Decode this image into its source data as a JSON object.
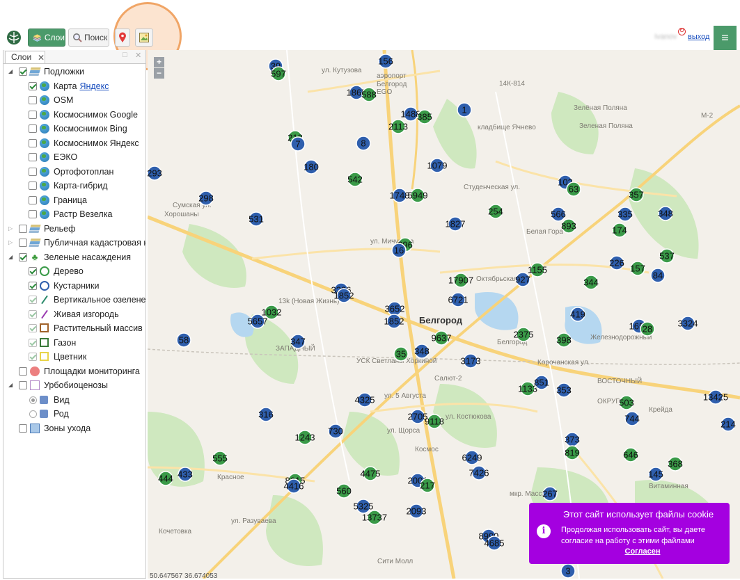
{
  "toolbar": {
    "layers_label": "Слои",
    "search_label": "Поиск",
    "user_name": "Ivanov",
    "logout_label": "выход",
    "menu_glyph": "≡"
  },
  "panel": {
    "tab_label": "Слои",
    "close_glyph": "✕",
    "items": [
      {
        "label": "Подложки"
      },
      {
        "label": "Карта ",
        "link": "Яндекс"
      },
      {
        "label": "OSM"
      },
      {
        "label": "Космоснимок Google"
      },
      {
        "label": "Космоснимок Bing"
      },
      {
        "label": "Космоснимок Яндекс"
      },
      {
        "label": "ЕЭКО"
      },
      {
        "label": "Ортофотоплан"
      },
      {
        "label": "Карта-гибрид"
      },
      {
        "label": "Граница"
      },
      {
        "label": "Растр Везелка"
      },
      {
        "label": "Рельеф"
      },
      {
        "label": "Публичная кадастровая карта"
      },
      {
        "label": "Зеленые насаждения"
      },
      {
        "label": "Дерево"
      },
      {
        "label": "Кустарники"
      },
      {
        "label": "Вертикальное озеленение"
      },
      {
        "label": "Живая изгородь"
      },
      {
        "label": "Растительный массив"
      },
      {
        "label": "Газон"
      },
      {
        "label": "Цветник"
      },
      {
        "label": "Площадки мониторинга"
      },
      {
        "label": "Урбобиоценозы"
      },
      {
        "label": "Вид"
      },
      {
        "label": "Род"
      },
      {
        "label": "Зоны ухода"
      }
    ]
  },
  "map": {
    "zoom_in": "+",
    "zoom_out": "−",
    "coords": "50.647567 36.674053",
    "city": "Белгород",
    "places": [
      {
        "t": "аэропорт"
      },
      {
        "t": "Белгород"
      },
      {
        "t": "EGO"
      },
      {
        "t": "Зелёная Поляна"
      },
      {
        "t": "Зеленая Поляна"
      },
      {
        "t": "кладбище Ячнево"
      },
      {
        "t": "Белая Гора"
      },
      {
        "t": "ул. Кутузова"
      },
      {
        "t": "Сумская ул."
      },
      {
        "t": "ул. Мичурина"
      },
      {
        "t": "Студенческая ул."
      },
      {
        "t": "Октябрьская ул."
      },
      {
        "t": "Железнодорожный"
      },
      {
        "t": "Корочанская ул."
      },
      {
        "t": "ВОСТОЧНЫЙ"
      },
      {
        "t": "ОКРУГ"
      },
      {
        "t": "ЗАПАДНЫЙ"
      },
      {
        "t": "УСК Светланы Хоркиной"
      },
      {
        "t": "Салют-2"
      },
      {
        "t": "ул. 5 Августа"
      },
      {
        "t": "ул. Костюкова"
      },
      {
        "t": "Космос"
      },
      {
        "t": "Красное"
      },
      {
        "t": "ул. Разуваева"
      },
      {
        "t": "ул. Щорса"
      },
      {
        "t": "Сити Молл"
      },
      {
        "t": "Витаминная"
      },
      {
        "t": "Крейда"
      },
      {
        "t": "13k (Новая Жизнь)"
      },
      {
        "t": "Белгород"
      },
      {
        "t": "14К-814"
      },
      {
        "t": "М-2"
      },
      {
        "t": "Хорошаны"
      },
      {
        "t": "мкр. Массив"
      },
      {
        "t": "Кочетовка"
      }
    ],
    "clusters": [
      {
        "n": "39",
        "c": "b"
      },
      {
        "n": "597",
        "c": "g"
      },
      {
        "n": "156",
        "c": "b"
      },
      {
        "n": "1865",
        "c": "b"
      },
      {
        "n": "588",
        "c": "g"
      },
      {
        "n": "1",
        "c": "b"
      },
      {
        "n": "1488",
        "c": "b"
      },
      {
        "n": "385",
        "c": "g"
      },
      {
        "n": "2113",
        "c": "g"
      },
      {
        "n": "213",
        "c": "g"
      },
      {
        "n": "7",
        "c": "b"
      },
      {
        "n": "8",
        "c": "b"
      },
      {
        "n": "293",
        "c": "b"
      },
      {
        "n": "180",
        "c": "b"
      },
      {
        "n": "1079",
        "c": "b"
      },
      {
        "n": "542",
        "c": "g"
      },
      {
        "n": "1748",
        "c": "b"
      },
      {
        "n": "5949",
        "c": "g"
      },
      {
        "n": "102",
        "c": "b"
      },
      {
        "n": "63",
        "c": "g"
      },
      {
        "n": "298",
        "c": "b"
      },
      {
        "n": "357",
        "c": "g"
      },
      {
        "n": "335",
        "c": "b"
      },
      {
        "n": "348",
        "c": "b"
      },
      {
        "n": "254",
        "c": "g"
      },
      {
        "n": "566",
        "c": "b"
      },
      {
        "n": "893",
        "c": "g"
      },
      {
        "n": "531",
        "c": "b"
      },
      {
        "n": "1827",
        "c": "b"
      },
      {
        "n": "174",
        "c": "g"
      },
      {
        "n": "296",
        "c": "g"
      },
      {
        "n": "16",
        "c": "b"
      },
      {
        "n": "537",
        "c": "g"
      },
      {
        "n": "226",
        "c": "b"
      },
      {
        "n": "157",
        "c": "g"
      },
      {
        "n": "84",
        "c": "b"
      },
      {
        "n": "1155",
        "c": "g"
      },
      {
        "n": "17907",
        "c": "g"
      },
      {
        "n": "927",
        "c": "b"
      },
      {
        "n": "344",
        "c": "g"
      },
      {
        "n": "3226",
        "c": "b"
      },
      {
        "n": "1852",
        "c": "b"
      },
      {
        "n": "6721",
        "c": "b"
      },
      {
        "n": "1032",
        "c": "g"
      },
      {
        "n": "3652",
        "c": "b"
      },
      {
        "n": "1852",
        "c": "b"
      },
      {
        "n": "419",
        "c": "b"
      },
      {
        "n": "5657",
        "c": "b"
      },
      {
        "n": "1659",
        "c": "b"
      },
      {
        "n": "28",
        "c": "g"
      },
      {
        "n": "3324",
        "c": "b"
      },
      {
        "n": "58",
        "c": "b"
      },
      {
        "n": "2375",
        "c": "g"
      },
      {
        "n": "347",
        "c": "b"
      },
      {
        "n": "9637",
        "c": "g"
      },
      {
        "n": "398",
        "c": "g"
      },
      {
        "n": "35",
        "c": "g"
      },
      {
        "n": "348",
        "c": "b"
      },
      {
        "n": "3173",
        "c": "b"
      },
      {
        "n": "1133",
        "c": "g"
      },
      {
        "n": "851",
        "c": "b"
      },
      {
        "n": "353",
        "c": "b"
      },
      {
        "n": "13425",
        "c": "b"
      },
      {
        "n": "4325",
        "c": "b"
      },
      {
        "n": "503",
        "c": "g"
      },
      {
        "n": "316",
        "c": "b"
      },
      {
        "n": "2705",
        "c": "b"
      },
      {
        "n": "9118",
        "c": "g"
      },
      {
        "n": "744",
        "c": "b"
      },
      {
        "n": "214",
        "c": "b"
      },
      {
        "n": "1243",
        "c": "g"
      },
      {
        "n": "730",
        "c": "b"
      },
      {
        "n": "373",
        "c": "b"
      },
      {
        "n": "819",
        "c": "g"
      },
      {
        "n": "555",
        "c": "g"
      },
      {
        "n": "6249",
        "c": "b"
      },
      {
        "n": "646",
        "c": "g"
      },
      {
        "n": "368",
        "c": "g"
      },
      {
        "n": "444",
        "c": "g"
      },
      {
        "n": "433",
        "c": "b"
      },
      {
        "n": "4475",
        "c": "g"
      },
      {
        "n": "7426",
        "c": "b"
      },
      {
        "n": "145",
        "c": "b"
      },
      {
        "n": "8615",
        "c": "g"
      },
      {
        "n": "4416",
        "c": "b"
      },
      {
        "n": "2001",
        "c": "b"
      },
      {
        "n": "217",
        "c": "g"
      },
      {
        "n": "560",
        "c": "g"
      },
      {
        "n": "267",
        "c": "b"
      },
      {
        "n": "5325",
        "c": "b"
      },
      {
        "n": "13737",
        "c": "g"
      },
      {
        "n": "2093",
        "c": "b"
      },
      {
        "n": "8999",
        "c": "b"
      },
      {
        "n": "4685",
        "c": "b"
      },
      {
        "n": "3",
        "c": "b"
      }
    ]
  },
  "cookie": {
    "title": "Этот сайт использует файлы cookie",
    "text": "Продолжая использовать сайт, вы даете согласие на работу с этими файлами",
    "ok": "Согласен"
  },
  "colors": {
    "accent": "#4b9a6a",
    "cluster_blue": "#2f5fad",
    "cluster_green": "#3a9a48",
    "cookie_bg": "#a400e0"
  }
}
